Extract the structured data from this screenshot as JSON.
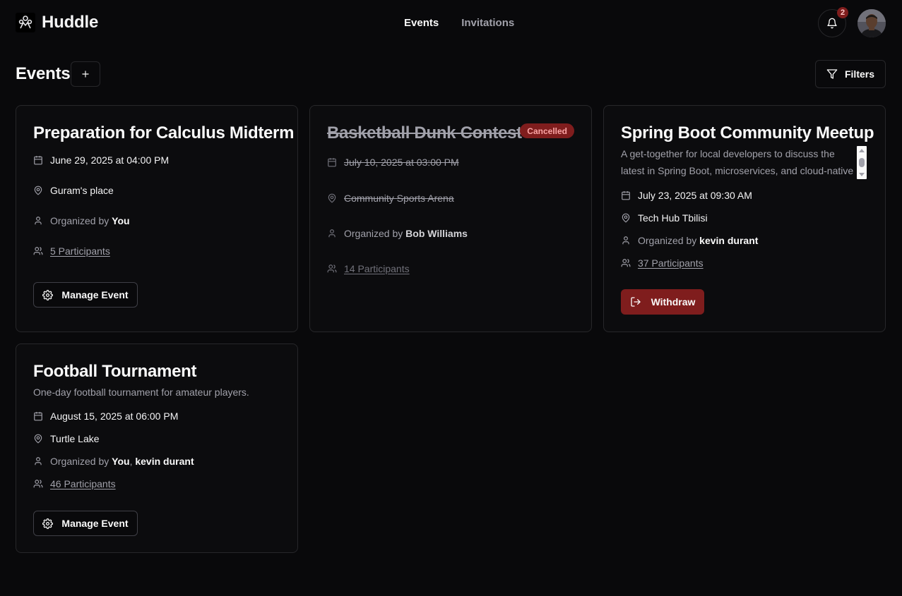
{
  "app": {
    "name": "Huddle"
  },
  "nav": {
    "events": "Events",
    "invitations": "Invitations"
  },
  "notifications": {
    "count": "2"
  },
  "page": {
    "title": "Events"
  },
  "toolbar": {
    "filters_label": "Filters"
  },
  "colors": {
    "background": "#09090b",
    "border": "#27272a",
    "danger": "#7f1d1d",
    "muted": "#a1a1aa"
  },
  "cards": [
    {
      "title": "Preparation for Calculus Midterm",
      "date": "June 29, 2025 at 04:00 PM",
      "location": "Guram's place",
      "organized_prefix": "Organized by",
      "organizer": "You",
      "participants": "5 Participants",
      "action": "Manage Event"
    },
    {
      "title": "Basketball Dunk Contest",
      "status": "Cancelled",
      "date": "July 10, 2025 at 03:00 PM",
      "location": "Community Sports Arena",
      "organized_prefix": "Organized by",
      "organizer": "Bob Williams",
      "participants": "14 Participants"
    },
    {
      "title": "Spring Boot Community Meetup",
      "description_line1": "A get-together for local developers to discuss the",
      "description_line2": "latest in Spring Boot, microservices, and cloud-native",
      "date": "July 23, 2025 at 09:30 AM",
      "location": "Tech Hub Tbilisi",
      "organized_prefix": "Organized by",
      "organizer": "kevin durant",
      "participants": "37 Participants",
      "action": "Withdraw"
    },
    {
      "title": "Football Tournament",
      "description": "One-day football tournament for amateur players.",
      "date": "August 15, 2025 at 06:00 PM",
      "location": "Turtle Lake",
      "organized_prefix": "Organized by",
      "organizer_1": "You",
      "organizer_sep": ",",
      "organizer_2": "kevin durant",
      "participants": "46 Participants",
      "action": "Manage Event"
    }
  ]
}
